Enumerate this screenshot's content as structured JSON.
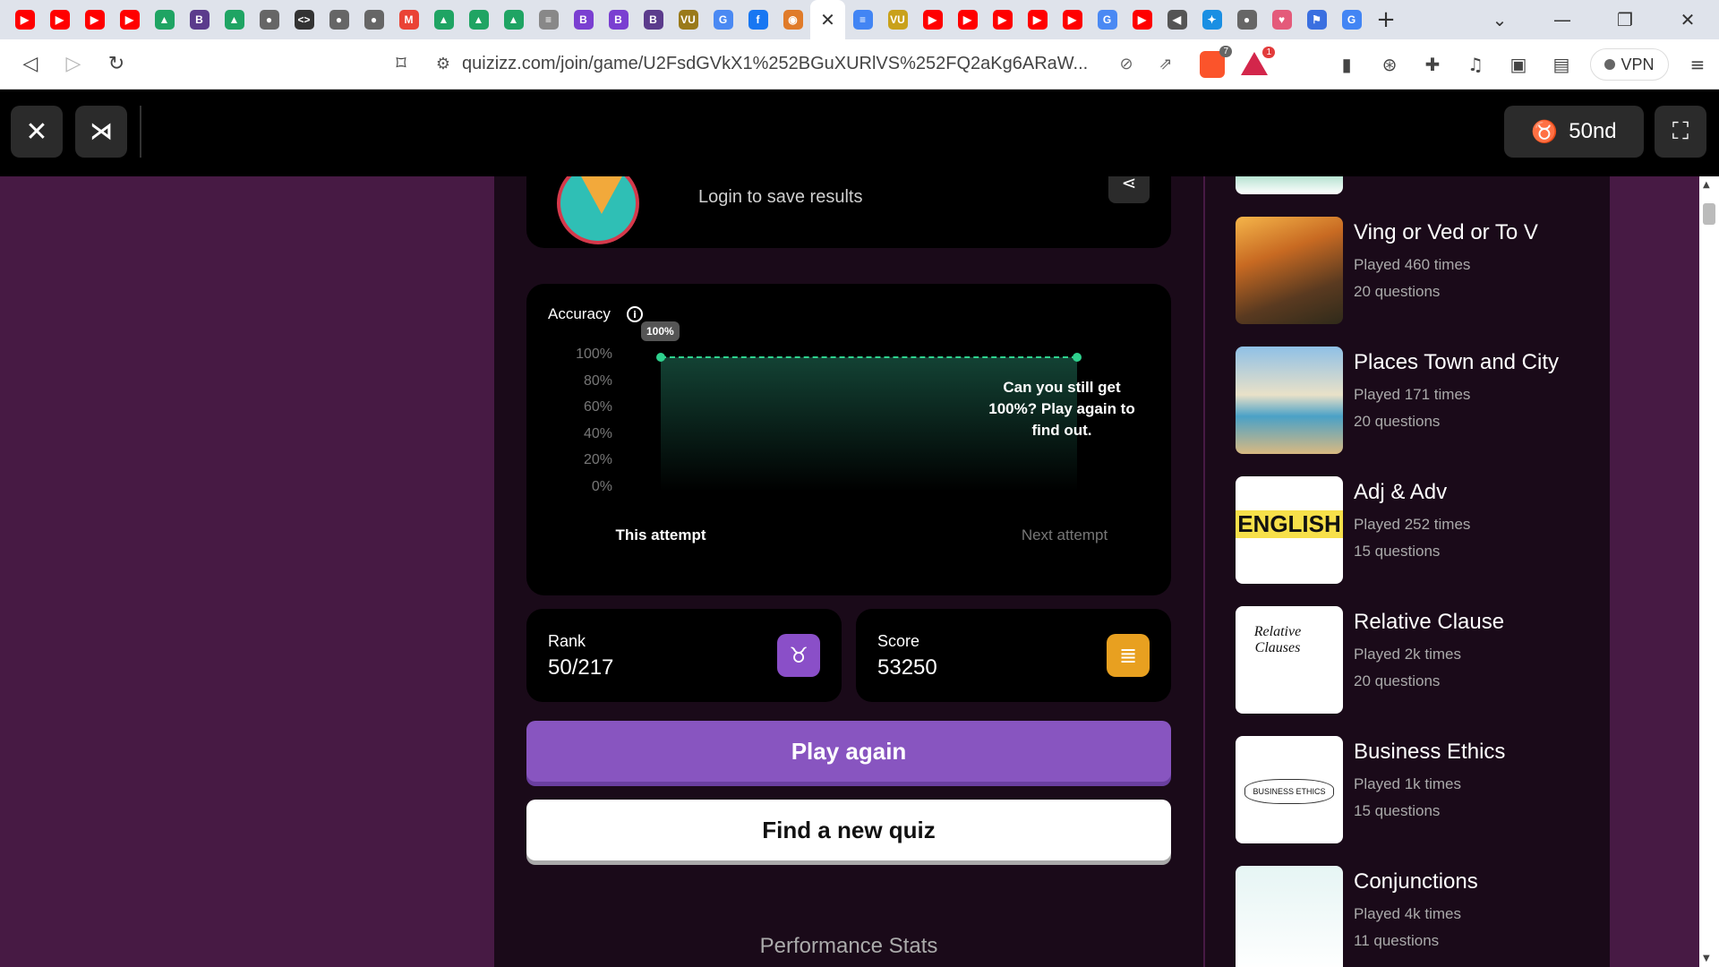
{
  "browser": {
    "tabs": [
      {
        "icon": "youtube-icon",
        "glyph": "▶",
        "color": "#ff0000"
      },
      {
        "icon": "youtube-icon",
        "glyph": "▶",
        "color": "#ff0000"
      },
      {
        "icon": "youtube-icon",
        "glyph": "▶",
        "color": "#ff0000"
      },
      {
        "icon": "youtube-icon",
        "glyph": "▶",
        "color": "#ff0000"
      },
      {
        "icon": "google-drive-icon",
        "glyph": "▲",
        "color": "#1fa463"
      },
      {
        "icon": "b-icon",
        "glyph": "B",
        "color": "#5b3b8c"
      },
      {
        "icon": "google-drive-icon",
        "glyph": "▲",
        "color": "#1fa463"
      },
      {
        "icon": "globe-icon",
        "glyph": "●",
        "color": "#666666"
      },
      {
        "icon": "code-icon",
        "glyph": "<>",
        "color": "#333333"
      },
      {
        "icon": "globe-icon",
        "glyph": "●",
        "color": "#666666"
      },
      {
        "icon": "globe-icon",
        "glyph": "●",
        "color": "#666666"
      },
      {
        "icon": "gmail-icon",
        "glyph": "M",
        "color": "#ea4335"
      },
      {
        "icon": "google-drive-icon",
        "glyph": "▲",
        "color": "#1fa463"
      },
      {
        "icon": "google-drive-icon",
        "glyph": "▲",
        "color": "#1fa463"
      },
      {
        "icon": "google-drive-icon",
        "glyph": "▲",
        "color": "#1fa463"
      },
      {
        "icon": "chat-icon",
        "glyph": "≡",
        "color": "#888888"
      },
      {
        "icon": "b-icon",
        "glyph": "B",
        "color": "#7a3fd1"
      },
      {
        "icon": "b-icon",
        "glyph": "B",
        "color": "#7a3fd1"
      },
      {
        "icon": "b-icon",
        "glyph": "B",
        "color": "#5b3b8c"
      },
      {
        "icon": "vu-icon",
        "glyph": "VU",
        "color": "#9a7a1a"
      },
      {
        "icon": "translate-icon",
        "glyph": "G",
        "color": "#4a89f3"
      },
      {
        "icon": "facebook-icon",
        "glyph": "f",
        "color": "#1877f2"
      },
      {
        "icon": "contacts-icon",
        "glyph": "◉",
        "color": "#e07b2a"
      },
      {
        "icon": "close-icon",
        "glyph": "✕",
        "color": "#ffffff",
        "active": true
      },
      {
        "icon": "docs-icon",
        "glyph": "≡",
        "color": "#4285f4"
      },
      {
        "icon": "vu-icon",
        "glyph": "VU",
        "color": "#c9a11a"
      },
      {
        "icon": "youtube-icon",
        "glyph": "▶",
        "color": "#ff0000"
      },
      {
        "icon": "youtube-icon",
        "glyph": "▶",
        "color": "#ff0000"
      },
      {
        "icon": "youtube-icon",
        "glyph": "▶",
        "color": "#ff0000"
      },
      {
        "icon": "youtube-icon",
        "glyph": "▶",
        "color": "#ff0000"
      },
      {
        "icon": "youtube-icon",
        "glyph": "▶",
        "color": "#ff0000"
      },
      {
        "icon": "translate-icon",
        "glyph": "G",
        "color": "#4a89f3"
      },
      {
        "icon": "youtube-icon",
        "glyph": "▶",
        "color": "#ff0000"
      },
      {
        "icon": "speaker-icon",
        "glyph": "◀",
        "color": "#555555"
      },
      {
        "icon": "puzzle-icon",
        "glyph": "✦",
        "color": "#1a8fe3"
      },
      {
        "icon": "globe-icon",
        "glyph": "●",
        "color": "#666666"
      },
      {
        "icon": "brave-icon",
        "glyph": "♥",
        "color": "#e45a7a"
      },
      {
        "icon": "flag-icon",
        "glyph": "⚑",
        "color": "#3a6fe0"
      },
      {
        "icon": "google-icon",
        "glyph": "G",
        "color": "#4285f4"
      }
    ],
    "new_tab": "+",
    "url": "quizizz.com/join/game/U2FsdGVkX1%252BGuXURlVS%252FQ2aKg6ARaW...",
    "shields_badge": "7",
    "rewards_badge": "1",
    "vpn_label": "VPN"
  },
  "quiz_header": {
    "rank_label": "50nd"
  },
  "profile": {
    "login_text": "Login to save results"
  },
  "accuracy": {
    "title": "Accuracy",
    "tooltip": "100%",
    "prompt": "Can you still get 100%? Play again to find out.",
    "chart_data": {
      "type": "area",
      "categories": [
        "This attempt",
        "Next attempt"
      ],
      "values": [
        100,
        100
      ],
      "y_ticks": [
        "100%",
        "80%",
        "60%",
        "40%",
        "20%",
        "0%"
      ],
      "ylim": [
        0,
        100
      ]
    }
  },
  "stats": {
    "rank_label": "Rank",
    "rank_value": "50/217",
    "score_label": "Score",
    "score_value": "53250"
  },
  "buttons": {
    "play_again": "Play again",
    "find_new_quiz": "Find a new quiz"
  },
  "performance_title": "Performance Stats",
  "recommended": [
    {
      "title": "Ving or Ved or To V",
      "played": "Played 460 times",
      "questions": "20 questions",
      "thumb": "mountain"
    },
    {
      "title": "Places Town and City",
      "played": "Played 171 times",
      "questions": "20 questions",
      "thumb": "beach"
    },
    {
      "title": "Adj & Adv",
      "played": "Played 252 times",
      "questions": "15 questions",
      "thumb": "english",
      "thumb_text": "ENGLISH"
    },
    {
      "title": "Relative Clause",
      "played": "Played 2k times",
      "questions": "20 questions",
      "thumb": "relative",
      "thumb_text": "Relative Clauses"
    },
    {
      "title": "Business Ethics",
      "played": "Played 1k times",
      "questions": "15 questions",
      "thumb": "ethics",
      "thumb_text": "BUSINESS ETHICS"
    },
    {
      "title": "Conjunctions",
      "played": "Played 4k times",
      "questions": "11 questions",
      "thumb": "conj"
    }
  ]
}
